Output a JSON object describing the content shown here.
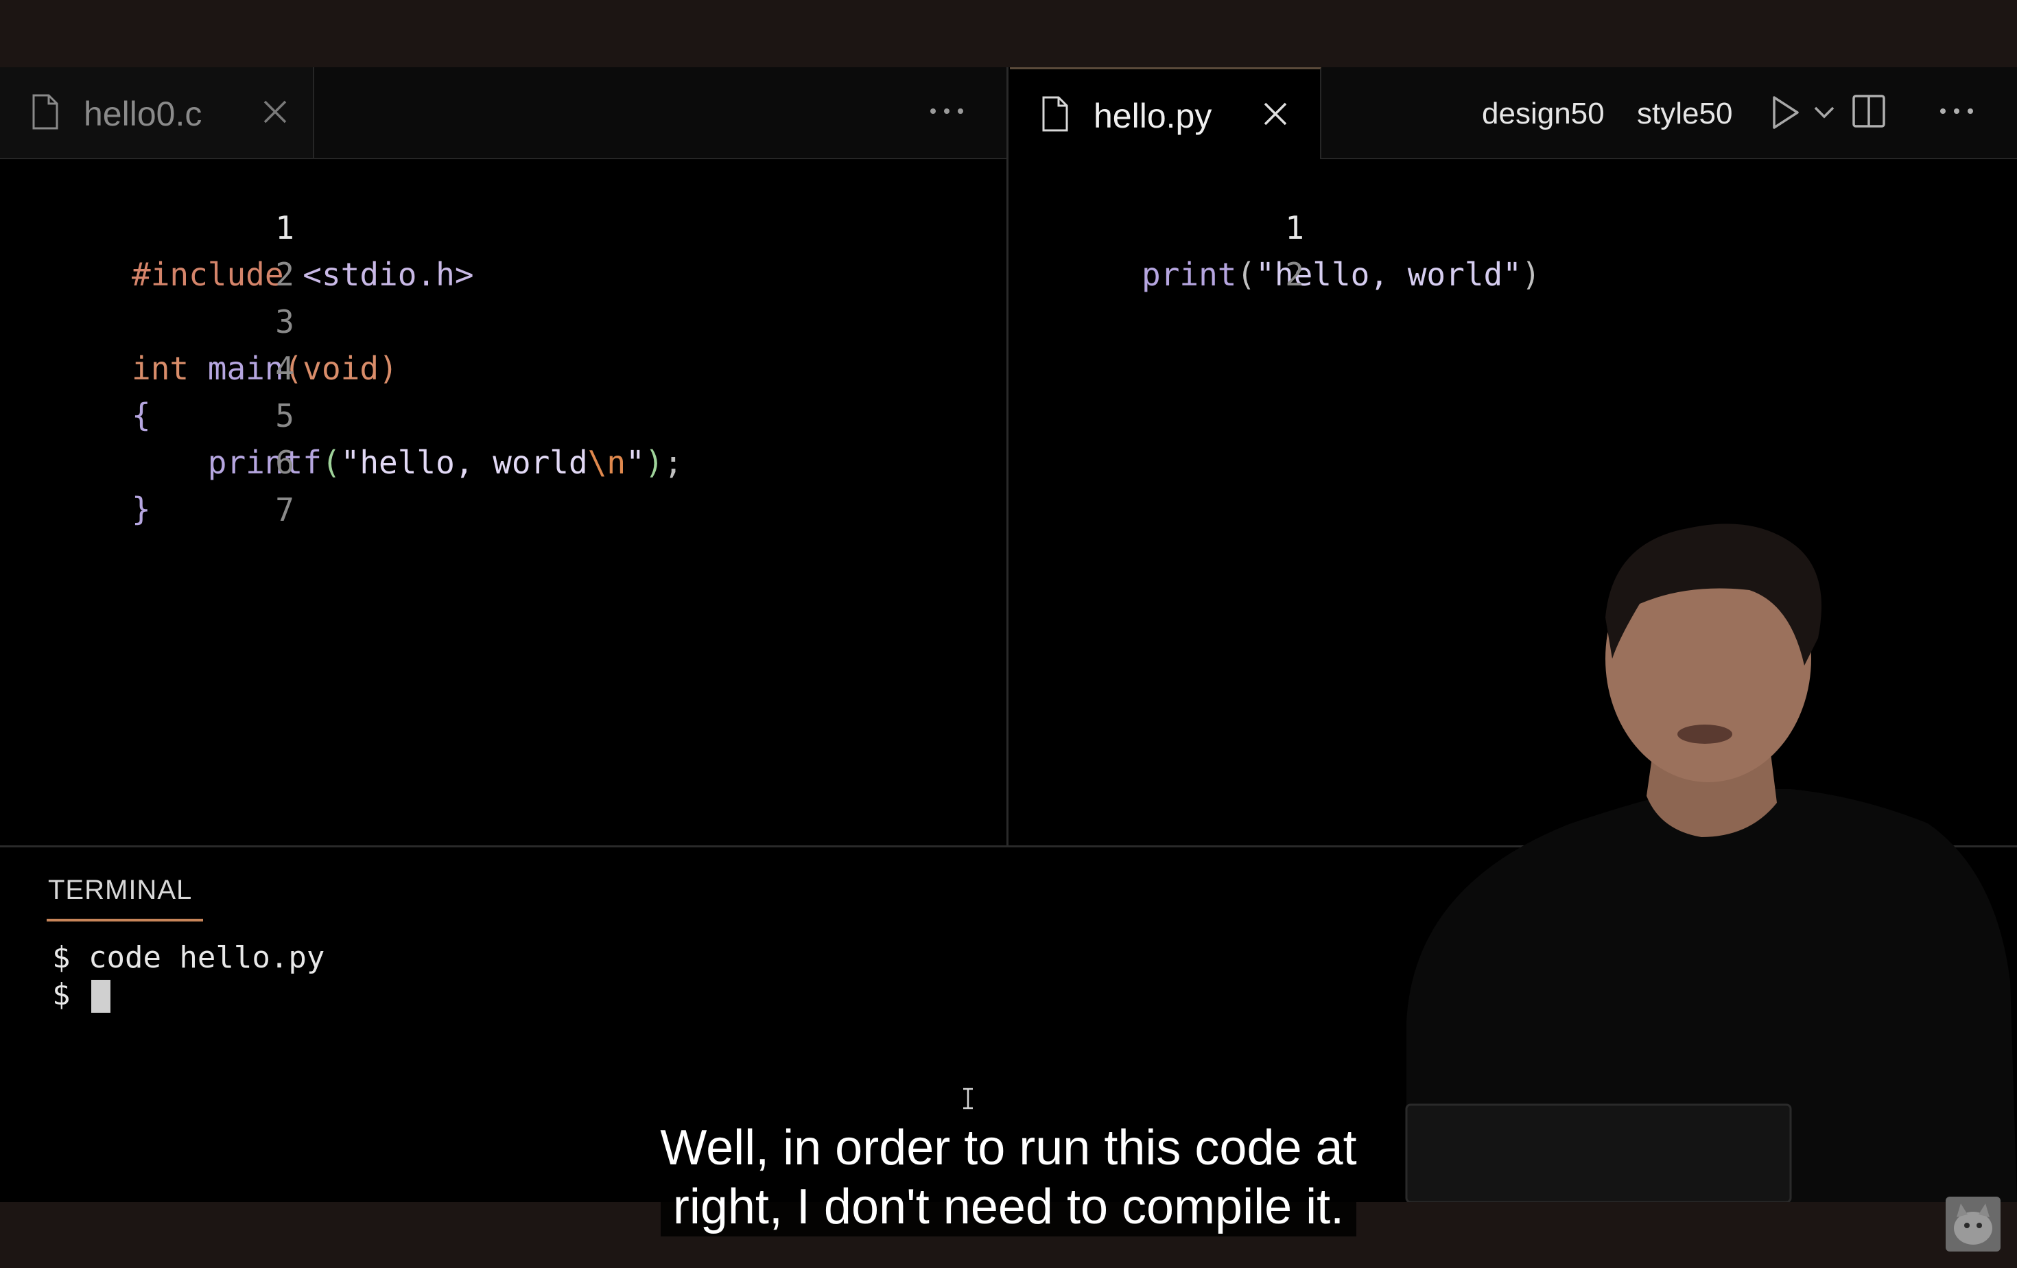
{
  "editor": {
    "left_pane": {
      "tab_label": "hello0.c",
      "lines": [
        {
          "num": "1",
          "text": "#include <stdio.h>"
        },
        {
          "num": "2",
          "text": ""
        },
        {
          "num": "3",
          "text": "int main(void)"
        },
        {
          "num": "4",
          "text": "{"
        },
        {
          "num": "5",
          "text": "    printf(\"hello, world\\n\");"
        },
        {
          "num": "6",
          "text": "}"
        },
        {
          "num": "7",
          "text": ""
        }
      ],
      "more_icon": "ellipsis-icon"
    },
    "right_pane": {
      "tab_label": "hello.py",
      "toolbar": {
        "design_label": "design50",
        "style_label": "style50"
      },
      "lines": [
        {
          "num": "1",
          "text": "print(\"hello, world\")"
        },
        {
          "num": "2",
          "text": ""
        }
      ]
    }
  },
  "terminal": {
    "tab_label": "TERMINAL",
    "lines": [
      "$ code hello.py",
      "$ "
    ]
  },
  "caption": {
    "line1": "Well, in order to run this code at",
    "line2": "right, I don't need to compile it."
  },
  "colors": {
    "accent": "#c8855a",
    "background": "#000000"
  }
}
